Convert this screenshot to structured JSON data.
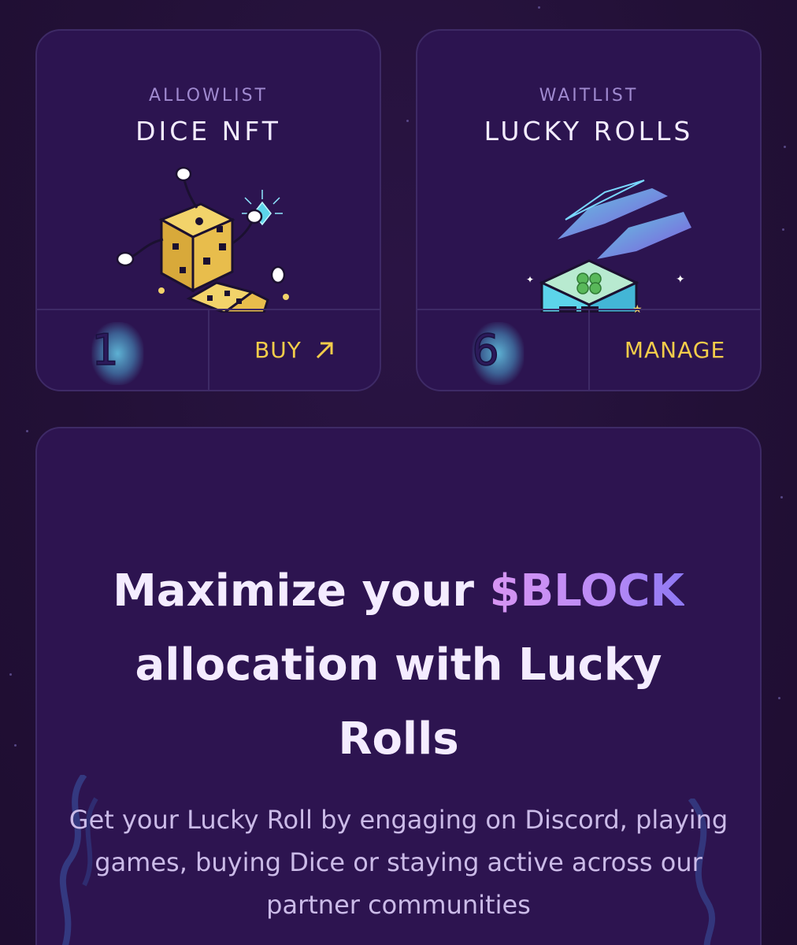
{
  "cards": [
    {
      "kicker": "ALLOWLIST",
      "title": "DICE NFT",
      "count": "1",
      "action_label": "BUY",
      "action_icon": "arrow-up-right-icon"
    },
    {
      "kicker": "WAITLIST",
      "title": "LUCKY ROLLS",
      "count": "6",
      "action_label": "MANAGE"
    }
  ],
  "promo": {
    "headline_before": "Maximize your ",
    "headline_accent": "$BLOCK",
    "headline_after": " allocation with Lucky Rolls",
    "body": "Get your Lucky Roll by engaging on Discord, playing games, buying Dice or staying active across our partner communities"
  },
  "colors": {
    "background": "#231038",
    "card": "#2c1450",
    "action": "#f3cc4a",
    "glow": "#6ee6ff",
    "accent_start": "#d795f2",
    "accent_end": "#8d78f4"
  }
}
